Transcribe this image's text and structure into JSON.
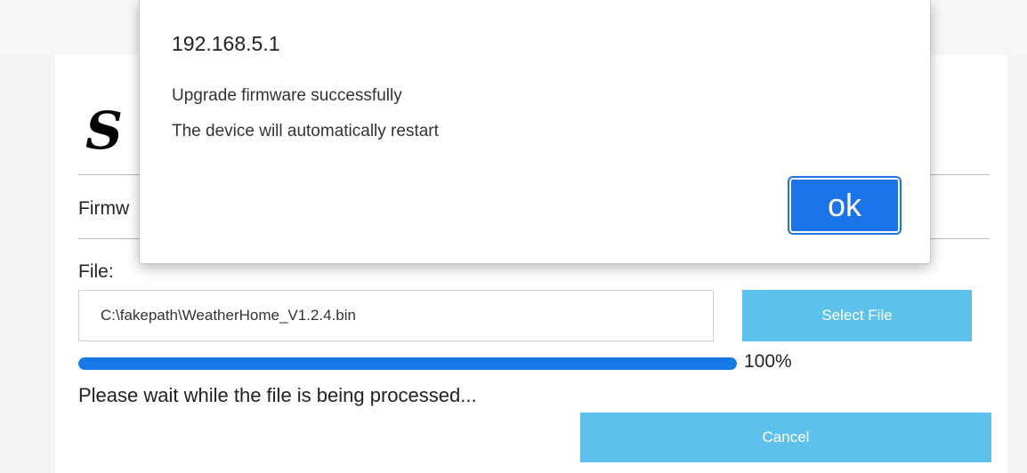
{
  "colors": {
    "accent_button": "#5ec1eb",
    "progress_fill": "#1779e6",
    "dialog_ok": "#1b73e8"
  },
  "page": {
    "logo_glyph": "S",
    "section_title_partial": "Firmw",
    "file_label": "File:",
    "file_path_value": "C:\\fakepath\\WeatherHome_V1.2.4.bin",
    "select_file_label": "Select File",
    "progress_fraction": 1.0,
    "progress_text": "100%",
    "wait_message": "Please wait while the file is being processed...",
    "cancel_label": "Cancel"
  },
  "dialog": {
    "host": "192.168.5.1",
    "message_line1": "Upgrade firmware successfully",
    "message_line2": "The device will automatically restart",
    "ok_label": "ok"
  }
}
